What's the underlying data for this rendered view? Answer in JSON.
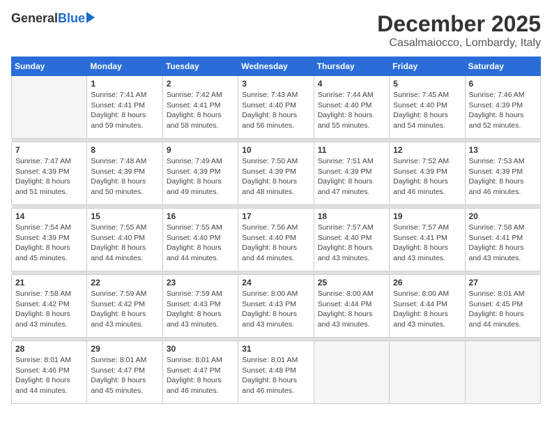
{
  "header": {
    "logo_general": "General",
    "logo_blue": "Blue",
    "month": "December 2025",
    "location": "Casalmaiocco, Lombardy, Italy"
  },
  "days_of_week": [
    "Sunday",
    "Monday",
    "Tuesday",
    "Wednesday",
    "Thursday",
    "Friday",
    "Saturday"
  ],
  "weeks": [
    [
      {
        "day": "",
        "info": ""
      },
      {
        "day": "1",
        "info": "Sunrise: 7:41 AM\nSunset: 4:41 PM\nDaylight: 8 hours\nand 59 minutes."
      },
      {
        "day": "2",
        "info": "Sunrise: 7:42 AM\nSunset: 4:41 PM\nDaylight: 8 hours\nand 58 minutes."
      },
      {
        "day": "3",
        "info": "Sunrise: 7:43 AM\nSunset: 4:40 PM\nDaylight: 8 hours\nand 56 minutes."
      },
      {
        "day": "4",
        "info": "Sunrise: 7:44 AM\nSunset: 4:40 PM\nDaylight: 8 hours\nand 55 minutes."
      },
      {
        "day": "5",
        "info": "Sunrise: 7:45 AM\nSunset: 4:40 PM\nDaylight: 8 hours\nand 54 minutes."
      },
      {
        "day": "6",
        "info": "Sunrise: 7:46 AM\nSunset: 4:39 PM\nDaylight: 8 hours\nand 52 minutes."
      }
    ],
    [
      {
        "day": "7",
        "info": "Sunrise: 7:47 AM\nSunset: 4:39 PM\nDaylight: 8 hours\nand 51 minutes."
      },
      {
        "day": "8",
        "info": "Sunrise: 7:48 AM\nSunset: 4:39 PM\nDaylight: 8 hours\nand 50 minutes."
      },
      {
        "day": "9",
        "info": "Sunrise: 7:49 AM\nSunset: 4:39 PM\nDaylight: 8 hours\nand 49 minutes."
      },
      {
        "day": "10",
        "info": "Sunrise: 7:50 AM\nSunset: 4:39 PM\nDaylight: 8 hours\nand 48 minutes."
      },
      {
        "day": "11",
        "info": "Sunrise: 7:51 AM\nSunset: 4:39 PM\nDaylight: 8 hours\nand 47 minutes."
      },
      {
        "day": "12",
        "info": "Sunrise: 7:52 AM\nSunset: 4:39 PM\nDaylight: 8 hours\nand 46 minutes."
      },
      {
        "day": "13",
        "info": "Sunrise: 7:53 AM\nSunset: 4:39 PM\nDaylight: 8 hours\nand 46 minutes."
      }
    ],
    [
      {
        "day": "14",
        "info": "Sunrise: 7:54 AM\nSunset: 4:39 PM\nDaylight: 8 hours\nand 45 minutes."
      },
      {
        "day": "15",
        "info": "Sunrise: 7:55 AM\nSunset: 4:40 PM\nDaylight: 8 hours\nand 44 minutes."
      },
      {
        "day": "16",
        "info": "Sunrise: 7:55 AM\nSunset: 4:40 PM\nDaylight: 8 hours\nand 44 minutes."
      },
      {
        "day": "17",
        "info": "Sunrise: 7:56 AM\nSunset: 4:40 PM\nDaylight: 8 hours\nand 44 minutes."
      },
      {
        "day": "18",
        "info": "Sunrise: 7:57 AM\nSunset: 4:40 PM\nDaylight: 8 hours\nand 43 minutes."
      },
      {
        "day": "19",
        "info": "Sunrise: 7:57 AM\nSunset: 4:41 PM\nDaylight: 8 hours\nand 43 minutes."
      },
      {
        "day": "20",
        "info": "Sunrise: 7:58 AM\nSunset: 4:41 PM\nDaylight: 8 hours\nand 43 minutes."
      }
    ],
    [
      {
        "day": "21",
        "info": "Sunrise: 7:58 AM\nSunset: 4:42 PM\nDaylight: 8 hours\nand 43 minutes."
      },
      {
        "day": "22",
        "info": "Sunrise: 7:59 AM\nSunset: 4:42 PM\nDaylight: 8 hours\nand 43 minutes."
      },
      {
        "day": "23",
        "info": "Sunrise: 7:59 AM\nSunset: 4:43 PM\nDaylight: 8 hours\nand 43 minutes."
      },
      {
        "day": "24",
        "info": "Sunrise: 8:00 AM\nSunset: 4:43 PM\nDaylight: 8 hours\nand 43 minutes."
      },
      {
        "day": "25",
        "info": "Sunrise: 8:00 AM\nSunset: 4:44 PM\nDaylight: 8 hours\nand 43 minutes."
      },
      {
        "day": "26",
        "info": "Sunrise: 8:00 AM\nSunset: 4:44 PM\nDaylight: 8 hours\nand 43 minutes."
      },
      {
        "day": "27",
        "info": "Sunrise: 8:01 AM\nSunset: 4:45 PM\nDaylight: 8 hours\nand 44 minutes."
      }
    ],
    [
      {
        "day": "28",
        "info": "Sunrise: 8:01 AM\nSunset: 4:46 PM\nDaylight: 8 hours\nand 44 minutes."
      },
      {
        "day": "29",
        "info": "Sunrise: 8:01 AM\nSunset: 4:47 PM\nDaylight: 8 hours\nand 45 minutes."
      },
      {
        "day": "30",
        "info": "Sunrise: 8:01 AM\nSunset: 4:47 PM\nDaylight: 8 hours\nand 46 minutes."
      },
      {
        "day": "31",
        "info": "Sunrise: 8:01 AM\nSunset: 4:48 PM\nDaylight: 8 hours\nand 46 minutes."
      },
      {
        "day": "",
        "info": ""
      },
      {
        "day": "",
        "info": ""
      },
      {
        "day": "",
        "info": ""
      }
    ]
  ]
}
